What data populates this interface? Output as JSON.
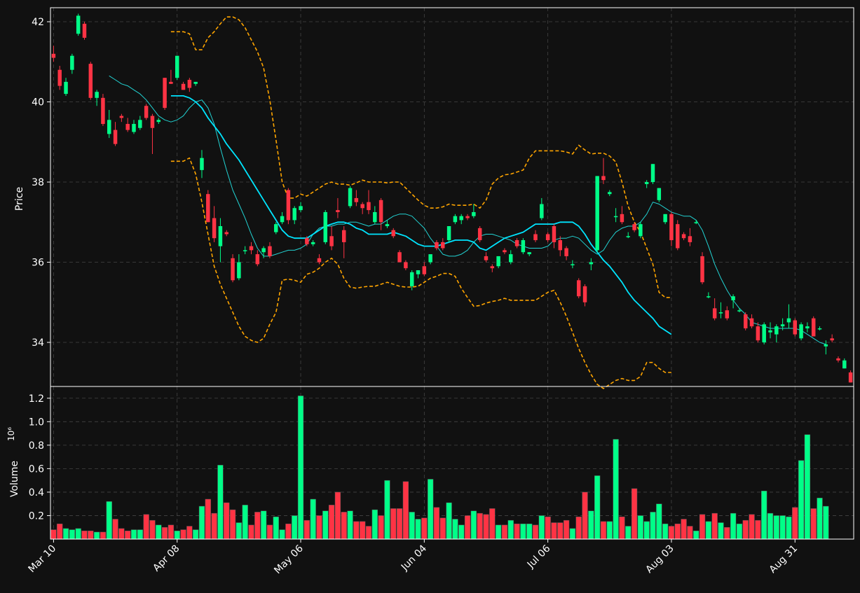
{
  "chart_data": {
    "type": "candlestick",
    "theme": {
      "background": "#111111",
      "up_color": "#00ff88",
      "down_color": "#ff3344",
      "grid_color": "#444444",
      "axis_color": "#ffffff",
      "ma_fast_color": "#22d3d3",
      "ma_slow_color": "#00e5ff",
      "band_color": "#ffa500"
    },
    "price_panel": {
      "ylabel": "Price",
      "ylim": [
        32.9,
        42.35
      ],
      "yticks": [
        34,
        36,
        38,
        40,
        42
      ]
    },
    "volume_panel": {
      "ylabel": "Volume",
      "ylabel_exponent": "10⁶",
      "ylim": [
        0,
        1.3
      ],
      "yticks": [
        0.2,
        0.4,
        0.6,
        0.8,
        1.0,
        1.2
      ],
      "ytick_labels": [
        "0.2",
        "0.4",
        "0.6",
        "0.8",
        "1.0",
        "1.2"
      ]
    },
    "x_tick_labels": [
      {
        "index": 0,
        "label": "Mar 10"
      },
      {
        "index": 20,
        "label": "Apr 08"
      },
      {
        "index": 40,
        "label": "May 06"
      },
      {
        "index": 60,
        "label": "Jun 04"
      },
      {
        "index": 80,
        "label": "Jul 06"
      },
      {
        "index": 100,
        "label": "Aug 03"
      },
      {
        "index": 120,
        "label": "Aug 31"
      }
    ],
    "ohlc": [
      [
        41.2,
        41.4,
        41.0,
        41.1
      ],
      [
        40.8,
        40.9,
        40.3,
        40.4
      ],
      [
        40.2,
        40.6,
        40.15,
        40.5
      ],
      [
        40.8,
        41.2,
        40.7,
        41.15
      ],
      [
        41.7,
        42.2,
        41.65,
        42.15
      ],
      [
        41.95,
        42.0,
        41.55,
        41.6
      ],
      [
        40.95,
        41.0,
        40.05,
        40.1
      ],
      [
        40.1,
        40.3,
        39.9,
        40.25
      ],
      [
        40.1,
        40.2,
        39.4,
        39.45
      ],
      [
        39.2,
        39.8,
        39.1,
        39.55
      ],
      [
        39.3,
        39.5,
        38.9,
        38.95
      ],
      [
        39.65,
        39.7,
        39.5,
        39.6
      ],
      [
        39.45,
        39.6,
        39.25,
        39.3
      ],
      [
        39.25,
        39.55,
        39.2,
        39.45
      ],
      [
        39.35,
        39.65,
        39.3,
        39.55
      ],
      [
        39.9,
        39.95,
        39.55,
        39.6
      ],
      [
        39.65,
        39.7,
        38.7,
        39.35
      ],
      [
        39.5,
        39.6,
        39.45,
        39.55
      ],
      [
        40.6,
        40.6,
        39.8,
        39.85
      ],
      [
        40.5,
        40.8,
        40.45,
        40.45
      ],
      [
        40.6,
        41.15,
        40.55,
        41.15
      ],
      [
        40.45,
        40.5,
        40.3,
        40.3
      ],
      [
        40.55,
        40.6,
        40.25,
        40.35
      ],
      [
        40.45,
        40.5,
        40.4,
        40.5
      ],
      [
        38.3,
        38.8,
        38.1,
        38.6
      ],
      [
        37.7,
        37.8,
        37.0,
        37.0
      ],
      [
        37.1,
        37.4,
        36.5,
        36.6
      ],
      [
        36.4,
        37.1,
        36.0,
        36.9
      ],
      [
        36.75,
        36.8,
        36.65,
        36.7
      ],
      [
        36.1,
        36.2,
        35.5,
        35.55
      ],
      [
        35.6,
        36.2,
        35.55,
        36.0
      ],
      [
        36.3,
        36.4,
        36.2,
        36.3
      ],
      [
        36.4,
        36.5,
        36.2,
        36.3
      ],
      [
        36.2,
        36.3,
        35.9,
        35.95
      ],
      [
        36.25,
        36.4,
        36.1,
        36.35
      ],
      [
        36.4,
        36.5,
        36.1,
        36.15
      ],
      [
        36.75,
        37.0,
        36.7,
        36.95
      ],
      [
        37.0,
        37.25,
        36.95,
        37.15
      ],
      [
        37.8,
        37.85,
        36.95,
        37.05
      ],
      [
        37.05,
        37.4,
        36.95,
        37.35
      ],
      [
        37.3,
        37.5,
        37.25,
        37.4
      ],
      [
        36.6,
        36.65,
        36.4,
        36.45
      ],
      [
        36.45,
        36.55,
        36.4,
        36.5
      ],
      [
        36.1,
        36.2,
        35.95,
        36.0
      ],
      [
        36.5,
        37.3,
        36.45,
        37.25
      ],
      [
        36.65,
        36.9,
        36.3,
        36.4
      ],
      [
        37.3,
        37.6,
        37.1,
        37.25
      ],
      [
        36.8,
        36.9,
        36.1,
        36.5
      ],
      [
        37.4,
        37.9,
        37.35,
        37.85
      ],
      [
        37.6,
        37.8,
        37.4,
        37.5
      ],
      [
        37.45,
        37.5,
        37.2,
        37.35
      ],
      [
        37.5,
        37.8,
        37.2,
        37.3
      ],
      [
        37.0,
        37.4,
        36.95,
        37.25
      ],
      [
        37.55,
        37.6,
        36.8,
        37.0
      ],
      [
        36.9,
        37.05,
        36.85,
        36.95
      ],
      [
        36.8,
        36.85,
        36.6,
        36.65
      ],
      [
        36.25,
        36.3,
        36.0,
        36.0
      ],
      [
        36.0,
        36.05,
        35.8,
        35.85
      ],
      [
        35.4,
        35.8,
        35.3,
        35.75
      ],
      [
        35.7,
        35.8,
        35.6,
        35.8
      ],
      [
        35.9,
        36.0,
        35.65,
        35.7
      ],
      [
        36.0,
        36.1,
        35.95,
        36.2
      ],
      [
        36.5,
        36.55,
        36.3,
        36.35
      ],
      [
        36.5,
        36.6,
        36.3,
        36.35
      ],
      [
        36.55,
        36.9,
        36.5,
        36.9
      ],
      [
        37.0,
        37.2,
        36.95,
        37.15
      ],
      [
        37.05,
        37.2,
        36.95,
        37.15
      ],
      [
        37.15,
        37.2,
        37.05,
        37.1
      ],
      [
        37.15,
        37.45,
        37.1,
        37.25
      ],
      [
        36.85,
        36.9,
        36.5,
        36.55
      ],
      [
        36.15,
        36.25,
        36.0,
        36.05
      ],
      [
        35.9,
        35.95,
        35.75,
        35.85
      ],
      [
        35.9,
        36.15,
        35.85,
        36.15
      ],
      [
        36.3,
        36.35,
        36.2,
        36.25
      ],
      [
        36.0,
        36.3,
        35.95,
        36.2
      ],
      [
        36.55,
        36.6,
        36.35,
        36.4
      ],
      [
        36.25,
        36.6,
        36.2,
        36.55
      ],
      [
        36.2,
        36.25,
        36.15,
        36.25
      ],
      [
        36.7,
        36.8,
        36.5,
        36.55
      ],
      [
        37.1,
        37.6,
        37.05,
        37.45
      ],
      [
        36.7,
        36.75,
        36.5,
        36.55
      ],
      [
        36.9,
        36.95,
        36.35,
        36.5
      ],
      [
        36.55,
        36.65,
        36.15,
        36.3
      ],
      [
        36.35,
        36.4,
        36.05,
        36.15
      ],
      [
        35.95,
        36.05,
        35.85,
        35.95
      ],
      [
        35.55,
        35.6,
        35.1,
        35.15
      ],
      [
        35.4,
        35.45,
        34.9,
        35.0
      ],
      [
        35.95,
        36.1,
        35.8,
        36.0
      ],
      [
        36.3,
        38.15,
        36.25,
        38.15
      ],
      [
        38.15,
        38.6,
        37.95,
        38.05
      ],
      [
        37.7,
        37.8,
        37.65,
        37.75
      ],
      [
        37.15,
        37.35,
        37.0,
        37.15
      ],
      [
        37.2,
        37.4,
        36.95,
        37.0
      ],
      [
        36.65,
        36.75,
        36.6,
        36.65
      ],
      [
        36.95,
        37.0,
        36.75,
        36.8
      ],
      [
        36.65,
        37.0,
        36.6,
        36.95
      ],
      [
        37.95,
        38.05,
        37.85,
        38.0
      ],
      [
        38.0,
        38.45,
        37.95,
        38.45
      ],
      [
        37.55,
        37.85,
        37.5,
        37.85
      ],
      [
        37.0,
        37.2,
        36.95,
        37.2
      ],
      [
        37.2,
        37.25,
        36.4,
        36.55
      ],
      [
        36.95,
        37.05,
        36.3,
        36.35
      ],
      [
        36.7,
        36.75,
        36.55,
        36.6
      ],
      [
        36.65,
        36.85,
        36.4,
        36.5
      ],
      [
        37.0,
        37.05,
        36.95,
        37.0
      ],
      [
        36.15,
        36.25,
        35.45,
        35.5
      ],
      [
        35.15,
        35.25,
        35.1,
        35.15
      ],
      [
        34.85,
        35.1,
        34.55,
        34.6
      ],
      [
        34.75,
        35.0,
        34.6,
        34.75
      ],
      [
        34.8,
        34.9,
        34.55,
        34.6
      ],
      [
        35.05,
        35.2,
        34.85,
        35.15
      ],
      [
        34.8,
        34.85,
        34.75,
        34.8
      ],
      [
        34.7,
        34.75,
        34.3,
        34.35
      ],
      [
        34.6,
        34.7,
        34.35,
        34.4
      ],
      [
        34.4,
        34.5,
        34.0,
        34.05
      ],
      [
        34.0,
        34.5,
        33.95,
        34.45
      ],
      [
        34.25,
        34.5,
        34.1,
        34.3
      ],
      [
        34.2,
        34.45,
        34.0,
        34.4
      ],
      [
        34.4,
        34.6,
        34.3,
        34.45
      ],
      [
        34.5,
        34.95,
        34.35,
        34.6
      ],
      [
        34.55,
        34.6,
        34.15,
        34.2
      ],
      [
        34.1,
        34.5,
        34.05,
        34.45
      ],
      [
        34.35,
        34.5,
        34.25,
        34.4
      ],
      [
        34.6,
        34.65,
        34.15,
        34.15
      ],
      [
        34.35,
        34.4,
        34.3,
        34.35
      ],
      [
        33.9,
        34.05,
        33.7,
        33.95
      ],
      [
        34.1,
        34.2,
        34.0,
        34.05
      ],
      [
        33.6,
        33.65,
        33.5,
        33.55
      ],
      [
        33.35,
        33.6,
        33.35,
        33.55
      ],
      [
        33.25,
        33.3,
        33.0,
        33.0
      ]
    ],
    "volume_millions": [
      0.08,
      0.13,
      0.09,
      0.08,
      0.09,
      0.07,
      0.07,
      0.06,
      0.06,
      0.32,
      0.17,
      0.09,
      0.07,
      0.08,
      0.08,
      0.21,
      0.16,
      0.12,
      0.1,
      0.12,
      0.07,
      0.08,
      0.11,
      0.08,
      0.28,
      0.34,
      0.22,
      0.63,
      0.31,
      0.25,
      0.14,
      0.29,
      0.12,
      0.23,
      0.24,
      0.12,
      0.19,
      0.08,
      0.13,
      0.2,
      1.22,
      0.16,
      0.34,
      0.2,
      0.24,
      0.29,
      0.4,
      0.23,
      0.24,
      0.15,
      0.15,
      0.11,
      0.25,
      0.2,
      0.5,
      0.26,
      0.26,
      0.49,
      0.23,
      0.17,
      0.18,
      0.51,
      0.27,
      0.18,
      0.31,
      0.17,
      0.12,
      0.2,
      0.24,
      0.22,
      0.21,
      0.26,
      0.12,
      0.12,
      0.16,
      0.13,
      0.13,
      0.13,
      0.12,
      0.2,
      0.19,
      0.14,
      0.14,
      0.16,
      0.09,
      0.19,
      0.4,
      0.24,
      0.54,
      0.15,
      0.15,
      0.85,
      0.19,
      0.11,
      0.43,
      0.2,
      0.15,
      0.23,
      0.3,
      0.13,
      0.11,
      0.13,
      0.17,
      0.11,
      0.07,
      0.21,
      0.15,
      0.22,
      0.14,
      0.1,
      0.22,
      0.13,
      0.16,
      0.21,
      0.16,
      0.41,
      0.22,
      0.2,
      0.2,
      0.19,
      0.27,
      0.67,
      0.89,
      0.26,
      0.35,
      0.28
    ],
    "moving_average_fast": {
      "start_index": 9,
      "values": [
        40.65,
        40.55,
        40.45,
        40.4,
        40.3,
        40.2,
        40.05,
        39.85,
        39.65,
        39.55,
        39.5,
        39.55,
        39.65,
        39.85,
        40.0,
        40.05,
        39.85,
        39.45,
        38.85,
        38.3,
        37.8,
        37.45,
        37.1,
        36.7,
        36.35,
        36.15,
        36.15,
        36.2,
        36.25,
        36.3,
        36.3,
        36.35,
        36.45,
        36.7,
        36.85,
        36.9,
        36.9,
        36.95,
        36.95,
        37.0,
        37.0,
        36.95,
        36.9,
        36.95,
        36.95,
        37.05,
        37.15,
        37.2,
        37.2,
        37.15,
        37.0,
        36.85,
        36.6,
        36.4,
        36.2,
        36.15,
        36.15,
        36.2,
        36.3,
        36.5,
        36.65,
        36.7,
        36.7,
        36.65,
        36.6,
        36.55,
        36.45,
        36.4,
        36.35,
        36.35,
        36.35,
        36.4,
        36.55,
        36.6,
        36.6,
        36.65,
        36.6,
        36.45,
        36.3,
        36.2,
        36.3,
        36.55,
        36.75,
        36.85,
        36.9,
        36.9,
        37.0,
        37.2,
        37.5,
        37.45,
        37.35,
        37.25,
        37.2,
        37.15,
        37.15,
        37.05,
        36.8,
        36.4,
        35.95,
        35.6,
        35.3,
        35.05,
        34.85,
        34.7,
        34.5,
        34.45,
        34.4,
        34.35,
        34.35,
        34.35,
        34.35,
        34.35,
        34.3,
        34.2,
        34.1,
        34.0,
        33.95
      ]
    },
    "moving_average_slow": {
      "start_index": 19,
      "values": [
        40.15,
        40.15,
        40.15,
        40.1,
        40.0,
        39.85,
        39.6,
        39.4,
        39.2,
        38.95,
        38.75,
        38.55,
        38.3,
        38.05,
        37.8,
        37.55,
        37.3,
        37.05,
        36.8,
        36.65,
        36.6,
        36.6,
        36.6,
        36.7,
        36.8,
        36.9,
        36.95,
        37.0,
        37.0,
        36.95,
        36.85,
        36.8,
        36.7,
        36.7,
        36.7,
        36.7,
        36.75,
        36.7,
        36.65,
        36.55,
        36.45,
        36.4,
        36.4,
        36.4,
        36.45,
        36.5,
        36.55,
        36.55,
        36.55,
        36.5,
        36.35,
        36.3,
        36.4,
        36.5,
        36.6,
        36.65,
        36.7,
        36.75,
        36.85,
        36.95,
        36.95,
        36.95,
        36.95,
        37.0,
        37.0,
        37.0,
        36.9,
        36.7,
        36.45,
        36.25,
        36.05,
        35.9,
        35.7,
        35.5,
        35.25,
        35.05,
        34.9,
        34.75,
        34.6,
        34.4,
        34.3,
        34.2
      ]
    },
    "upper_band": {
      "start_index": 19,
      "values": [
        41.75,
        41.75,
        41.75,
        41.7,
        41.3,
        41.3,
        41.6,
        41.75,
        41.95,
        42.12,
        42.12,
        42.05,
        41.85,
        41.55,
        41.25,
        40.85,
        40.05,
        39.05,
        38.0,
        37.6,
        37.6,
        37.7,
        37.65,
        37.75,
        37.85,
        37.95,
        38.0,
        37.95,
        37.95,
        37.92,
        37.98,
        38.05,
        38.0,
        38.0,
        38.0,
        37.98,
        38.0,
        38.0,
        37.85,
        37.7,
        37.55,
        37.42,
        37.35,
        37.35,
        37.38,
        37.45,
        37.42,
        37.42,
        37.42,
        37.45,
        37.35,
        37.55,
        37.95,
        38.1,
        38.18,
        38.2,
        38.25,
        38.3,
        38.6,
        38.78,
        38.78,
        38.78,
        38.78,
        38.78,
        38.75,
        38.7,
        38.92,
        38.8,
        38.7,
        38.72,
        38.72,
        38.65,
        38.5,
        38.0,
        37.4,
        37.0,
        36.75,
        36.35,
        35.95,
        35.25,
        35.12,
        35.12
      ]
    },
    "lower_band": {
      "start_index": 19,
      "values": [
        38.52,
        38.52,
        38.52,
        38.6,
        38.2,
        37.5,
        36.7,
        35.9,
        35.45,
        35.1,
        34.75,
        34.4,
        34.15,
        34.05,
        34.0,
        34.1,
        34.45,
        34.75,
        35.55,
        35.58,
        35.55,
        35.5,
        35.7,
        35.75,
        35.85,
        36.0,
        36.1,
        35.95,
        35.6,
        35.38,
        35.35,
        35.38,
        35.4,
        35.4,
        35.45,
        35.5,
        35.45,
        35.4,
        35.38,
        35.38,
        35.4,
        35.5,
        35.6,
        35.65,
        35.72,
        35.72,
        35.65,
        35.35,
        35.12,
        34.9,
        34.92,
        34.98,
        35.02,
        35.05,
        35.1,
        35.05,
        35.05,
        35.05,
        35.05,
        35.05,
        35.15,
        35.25,
        35.3,
        35.0,
        34.65,
        34.25,
        33.85,
        33.5,
        33.2,
        32.95,
        32.85,
        32.95,
        33.05,
        33.1,
        33.05,
        33.05,
        33.15,
        33.5,
        33.5,
        33.35,
        33.25,
        33.25
      ]
    }
  }
}
